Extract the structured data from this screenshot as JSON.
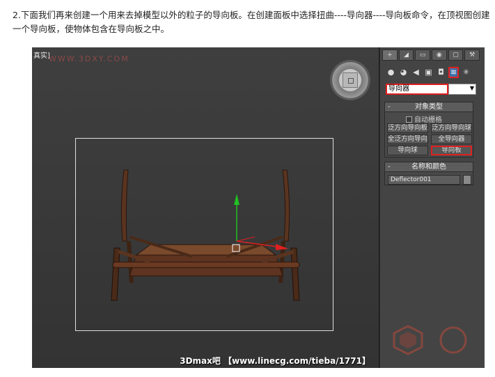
{
  "intro": {
    "text": "2.下面我们再来创建一个用来去掉模型以外的粒子的导向板。在创建面板中选择扭曲----导向器----导向板命令，在顶视图创建一个导向板，使物体包含在导向板之中。"
  },
  "viewport": {
    "label": "真实]",
    "watermark_top": "WWW.3DXY.COM",
    "watermark_bottom": "3Dmax吧 【www.linecg.com/tieba/1771】"
  },
  "panel": {
    "tabs": [
      "+",
      "◢",
      "▭",
      "◉",
      "▢",
      "⚒"
    ],
    "categories": [
      "●",
      "◕",
      "◀",
      "▣",
      "◘",
      "≋",
      "✳"
    ],
    "type_dropdown": "导向器",
    "object_type": {
      "title": "对象类型",
      "autogrid": "自动栅格",
      "buttons": [
        "泛方向导向板",
        "泛方向导向球",
        "全泛方向导向",
        "全导向器",
        "导向球",
        "导向板"
      ]
    },
    "name_color": {
      "title": "名称和颜色",
      "name_value": "Deflector001"
    }
  },
  "colors": {
    "highlight": "#e02020",
    "panel_bg": "#444444",
    "viewport_bg": "#3a3a3a",
    "wood": "#6b3a22"
  }
}
